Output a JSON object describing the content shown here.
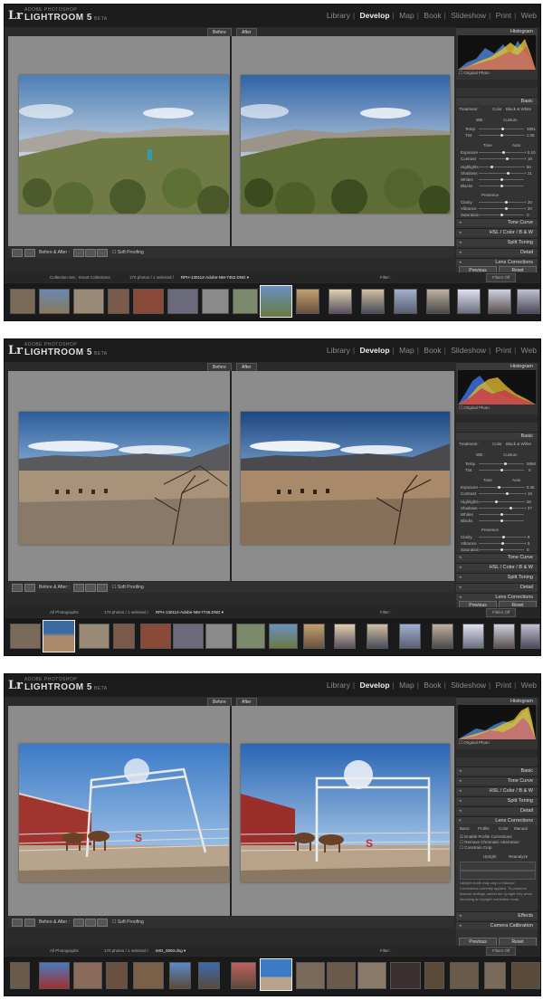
{
  "app": {
    "logo": "Lr",
    "small_name": "ADOBE PHOTOSHOP",
    "name": "LIGHTROOM 5",
    "beta": "BETA"
  },
  "modules": [
    "Library",
    "Develop",
    "Map",
    "Book",
    "Slideshow",
    "Print",
    "Web"
  ],
  "active_module": "Develop",
  "colors": {
    "accent_active": "#f0f0f0",
    "panel_bg": "#333333",
    "canvas_bg": "#8c8c8c"
  },
  "views": {
    "before": "Before",
    "after": "After"
  },
  "toolbar": {
    "before_after": "Before & After :",
    "soft_proofing": "Soft Proofing"
  },
  "panel": {
    "histogram": "Histogram",
    "original_photo": "Original Photo",
    "basic": "Basic",
    "treatment": "Treatment :",
    "color": "Color",
    "bw": "Black & White",
    "wb": "WB :",
    "wb_value": "Custom",
    "tone": "Tone",
    "auto": "Auto",
    "presence": "Presence",
    "tone_curve": "Tone Curve",
    "hsl": "HSL / Color / B & W",
    "split_toning": "Split Toning",
    "detail": "Detail",
    "lens_corrections": "Lens Corrections",
    "effects": "Effects",
    "camera_calibration": "Camera Calibration",
    "previous": "Previous",
    "reset": "Reset",
    "lens_tabs": [
      "Basic",
      "Profile",
      "Color",
      "Manual"
    ],
    "enable_profile": "Enable Profile Corrections",
    "remove_ca": "Remove Chromatic Aberration",
    "constrain_crop": "Constrain Crop",
    "upright": "Upright",
    "reanalyze": "Reanalyze",
    "upright_note": "Upright mode may crop or Manual Corrections currently applied. To preserve Manual settings, select the Upright Key when choosing an Upright correction mode.",
    "slider_labels": [
      "Temp",
      "Tint",
      "Exposure",
      "Contrast",
      "Highlights",
      "Shadows",
      "Whites",
      "Blacks",
      "Clarity",
      "Vibrance",
      "Saturation"
    ]
  },
  "filter": {
    "label": "Filter :",
    "status": "Filters Off"
  },
  "screenshots": [
    {
      "id": "shot1",
      "source": "Collection Set : Smart Collections",
      "count": "170 photos / 1 selected /",
      "file": "RPH-130112-Adobe-NM-7452.DNG ▾",
      "wb_temp": "4851",
      "wb_tint": "- 1.06",
      "values": [
        "+ 0.10",
        "+ 19",
        "- 56",
        "+ 21",
        "+ 20",
        "+ 20",
        "0"
      ]
    },
    {
      "id": "shot2",
      "source": "All Photographs",
      "count": "170 photos / 1 selected /",
      "file": "RPH-130112-Adobe-NM-7745.DNG ▾",
      "wb_temp": "5950",
      "wb_tint": "0",
      "values": [
        "- 0.36",
        "+ 19",
        "- 28",
        "+ 37",
        "+ 9",
        "+ 5",
        "0"
      ]
    },
    {
      "id": "shot3",
      "source": "All Photographs",
      "count": "170 photos / 1 selected /",
      "file": "IMG_0093.dng ▾"
    }
  ]
}
